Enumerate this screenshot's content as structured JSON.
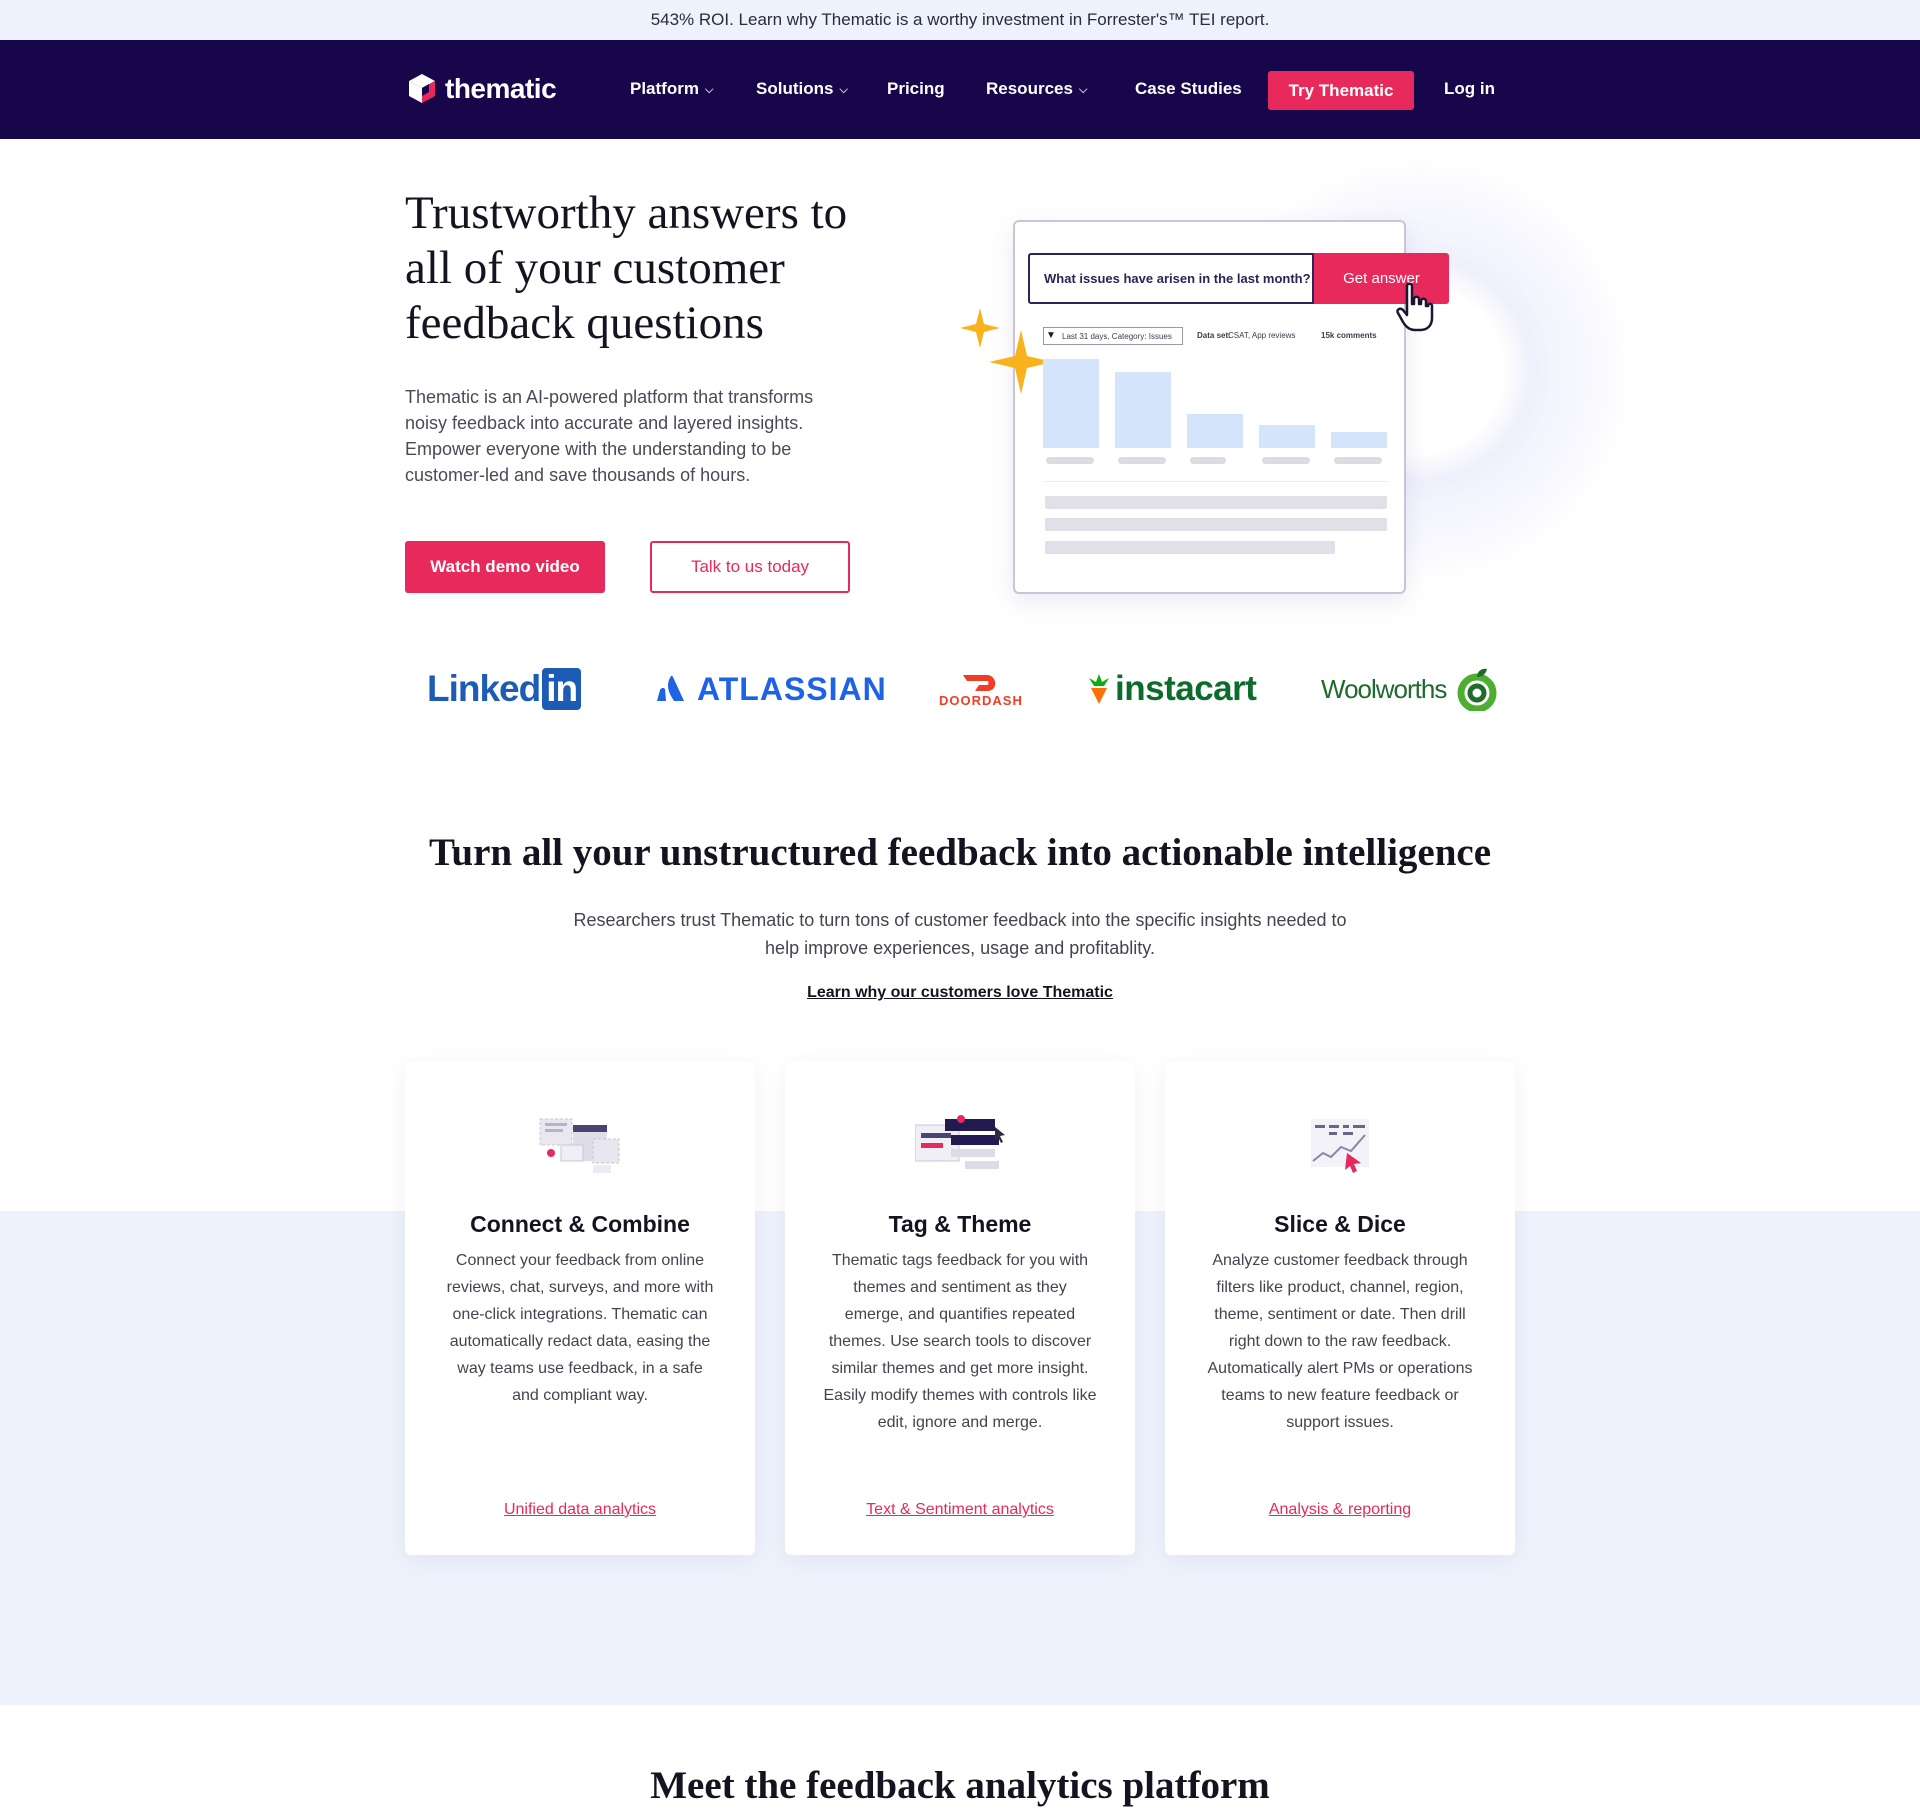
{
  "announcement": {
    "text": "543% ROI. Learn why Thematic is a worthy investment in Forrester's™ TEI report."
  },
  "nav": {
    "logo_text": "thematic",
    "items": [
      {
        "label": "Platform",
        "has_menu": true
      },
      {
        "label": "Solutions",
        "has_menu": true
      },
      {
        "label": "Pricing",
        "has_menu": false
      },
      {
        "label": "Resources",
        "has_menu": true
      },
      {
        "label": "Case Studies",
        "has_menu": false
      }
    ],
    "cta_label": "Try Thematic",
    "login_label": "Log in"
  },
  "hero": {
    "title": "Trustworthy answers to all of your customer feedback questions",
    "description": "Thematic is an AI-powered platform that transforms noisy feedback into accurate and layered insights. Empower everyone with the understanding to be customer-led and save thousands of hours.",
    "primary_button": "Watch demo video",
    "secondary_button": "Talk to us today",
    "mock": {
      "search_text": "What issues have arisen in the last month?",
      "search_button": "Get answer",
      "filter_label": "Last 31 days, Category: Issues",
      "dataset_label": "Data set:",
      "dataset_value": "CSAT, App reviews",
      "comments_label": "15k comments",
      "bar_levels": [
        1.0,
        0.85,
        0.38,
        0.26,
        0.18
      ]
    }
  },
  "brands": {
    "linkedin": "Linked",
    "linkedin_box": "in",
    "atlassian": "ATLASSIAN",
    "doordash": "DOORDASH",
    "instacart": "instacart",
    "woolworths": "Woolworths"
  },
  "section": {
    "title": "Turn all your unstructured feedback into actionable intelligence",
    "subtitle": "Researchers trust Thematic to turn tons of customer feedback into the specific insights needed to help improve experiences, usage and profitablity.",
    "link": "Learn why our customers love Thematic"
  },
  "cards": [
    {
      "title": "Connect & Combine",
      "body": "Connect your feedback from online reviews, chat, surveys, and more with one-click integrations. Thematic can automatically redact data, easing the way teams use feedback, in a safe and compliant way.",
      "link": "Unified data analytics",
      "icon": "integrations-icon"
    },
    {
      "title": "Tag & Theme",
      "body": "Thematic tags feedback for you with themes and sentiment as they emerge, and quantifies repeated themes. Use search tools to discover similar themes and get more insight. Easily modify themes with controls like edit, ignore and merge.",
      "link": "Text & Sentiment analytics",
      "icon": "themes-icon"
    },
    {
      "title": "Slice & Dice",
      "body": "Analyze customer feedback through filters like product, channel, region, theme, sentiment or date. Then drill right down to the raw feedback. Automatically alert PMs or operations teams to new feature feedback or support issues.",
      "link": "Analysis & reporting",
      "icon": "analytics-icon"
    }
  ],
  "next_section": {
    "title": "Meet the feedback analytics platform"
  },
  "colors": {
    "brand_red": "#e8295b",
    "nav_bg": "#17064a",
    "band_bg": "#eef2fc"
  }
}
